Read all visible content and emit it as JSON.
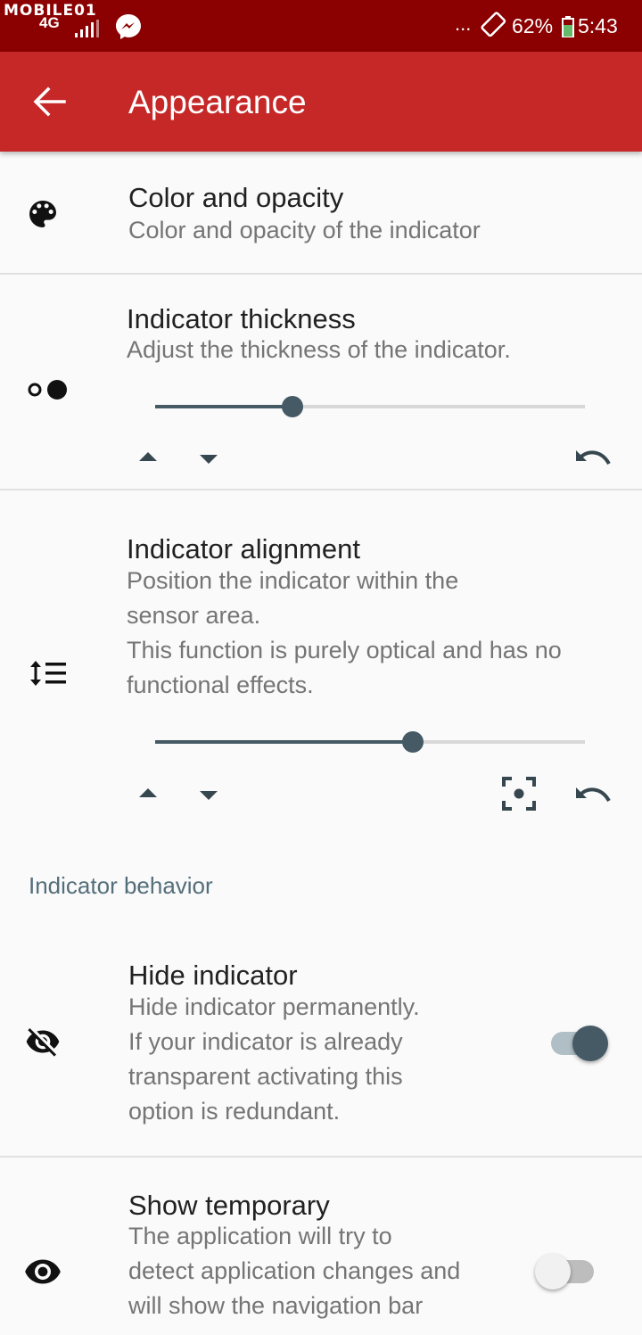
{
  "status_bar": {
    "watermark": "MOBILE01",
    "network": "4G",
    "dots": "...",
    "battery": "62%",
    "time": "5:43"
  },
  "toolbar": {
    "title": "Appearance"
  },
  "items": {
    "color": {
      "title": "Color and opacity",
      "summary": "Color and opacity of the indicator"
    },
    "thickness": {
      "title": "Indicator thickness",
      "summary": "Adjust the thickness of the indicator.",
      "value_fraction": 0.32
    },
    "alignment": {
      "title": "Indicator alignment",
      "summary_1": "Position the indicator within the",
      "summary_2": "sensor area.",
      "summary_3": "This function is purely optical and has no",
      "summary_4": "functional effects.",
      "value_fraction": 0.6
    },
    "hide": {
      "title": "Hide indicator",
      "summary_1": "Hide indicator permanently.",
      "summary_2": "If your indicator is already",
      "summary_3": "transparent activating this",
      "summary_4": "option is redundant.",
      "checked": true
    },
    "temporary": {
      "title": "Show temporary",
      "summary_1": "The application will try to",
      "summary_2": "detect application changes and",
      "summary_3": "will show the navigation bar",
      "checked": false
    }
  },
  "section_behavior": "Indicator behavior",
  "colors": {
    "status_bar": "#8b0000",
    "toolbar": "#c62828",
    "accent": "#455a64"
  }
}
